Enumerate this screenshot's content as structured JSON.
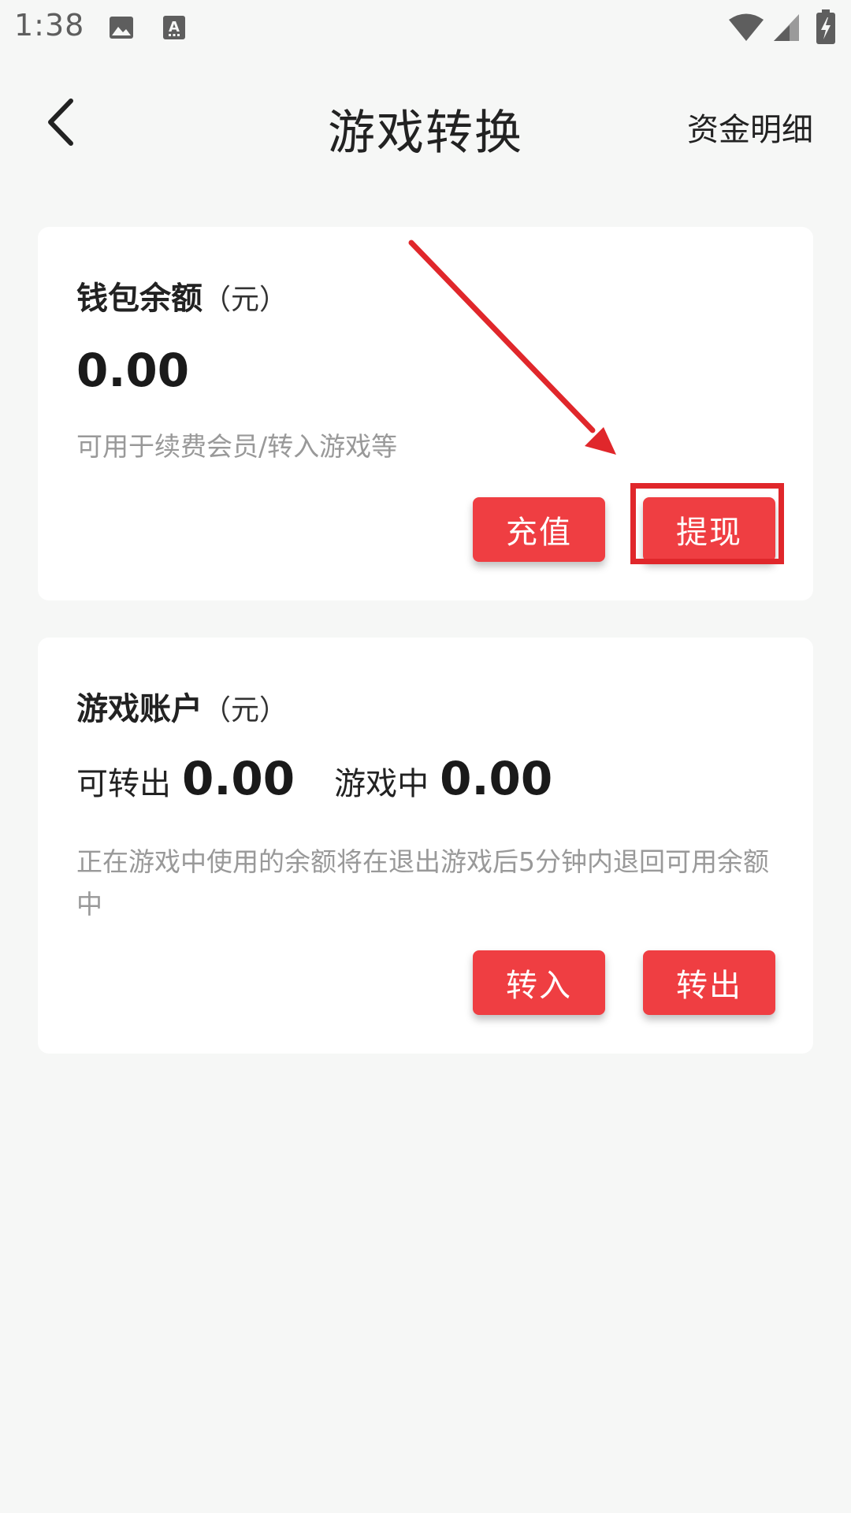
{
  "status_bar": {
    "time": "1:38",
    "icons": [
      "image-icon",
      "text-notification-icon",
      "wifi-icon",
      "signal-icon",
      "battery-charging-icon"
    ]
  },
  "header": {
    "title": "游戏转换",
    "right_link": "资金明细",
    "back_icon": "chevron-left-icon"
  },
  "wallet": {
    "title": "钱包余额",
    "unit": "（元）",
    "amount": "0.00",
    "hint": "可用于续费会员/转入游戏等",
    "buttons": {
      "recharge": "充值",
      "withdraw": "提现"
    }
  },
  "game_account": {
    "title": "游戏账户",
    "unit": "（元）",
    "transferable_label": "可转出",
    "transferable_amount": "0.00",
    "in_game_label": "游戏中",
    "in_game_amount": "0.00",
    "hint": "正在游戏中使用的余额将在退出游戏后5分钟内退回可用余额中",
    "buttons": {
      "transfer_in": "转入",
      "transfer_out": "转出"
    }
  },
  "colors": {
    "accent": "#ef3e42",
    "annotation": "#e0272b",
    "background": "#f6f7f6"
  }
}
